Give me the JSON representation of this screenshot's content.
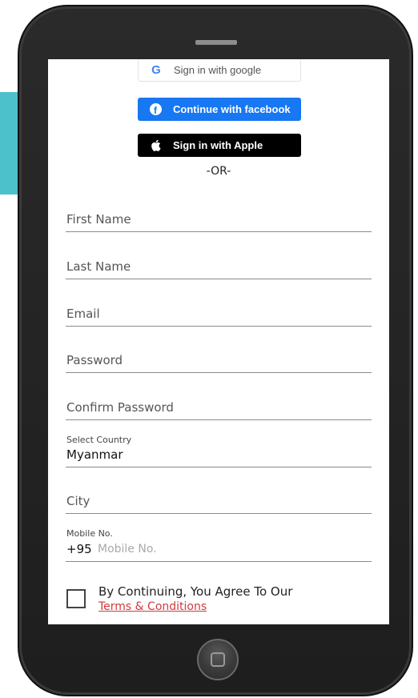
{
  "social": {
    "google_label": "Sign in with google",
    "facebook_label": "Continue with facebook",
    "apple_label": "Sign in with Apple"
  },
  "divider_text": "-OR-",
  "form": {
    "first_name_placeholder": "First Name",
    "last_name_placeholder": "Last Name",
    "email_placeholder": "Email",
    "password_placeholder": "Password",
    "confirm_password_placeholder": "Confirm Password",
    "country_label": "Select Country",
    "country_value": "Myanmar",
    "city_placeholder": "City",
    "mobile_label": "Mobile No.",
    "mobile_prefix": "+95",
    "mobile_placeholder": "Mobile No."
  },
  "agreement": {
    "text": "By Continuing, You Agree To Our",
    "terms_link": "Terms & Conditions"
  },
  "colors": {
    "facebook": "#1877f2",
    "apple": "#000000",
    "google_g": "#4285f4",
    "terms_link": "#d23a3a",
    "accent_strip": "#4cc1cc"
  }
}
